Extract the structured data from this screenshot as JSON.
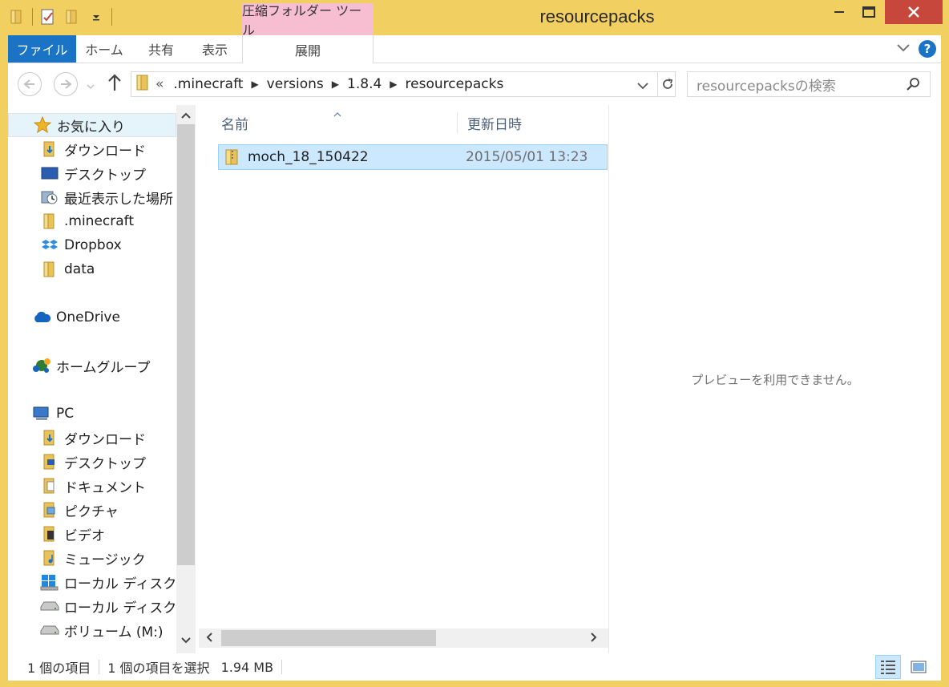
{
  "window": {
    "title": "resourcepacks",
    "context_tab_group": "圧縮フォルダー ツール"
  },
  "ribbon": {
    "tabs": [
      "ファイル",
      "ホーム",
      "共有",
      "表示",
      "展開"
    ]
  },
  "address_bar": {
    "overflow": "«",
    "crumbs": [
      ".minecraft",
      "versions",
      "1.8.4",
      "resourcepacks"
    ]
  },
  "search": {
    "placeholder": "resourcepacksの検索"
  },
  "nav_pane": {
    "favorites": {
      "label": "お気に入り",
      "items": [
        "ダウンロード",
        "デスクトップ",
        "最近表示した場所",
        ".minecraft",
        "Dropbox",
        "data"
      ]
    },
    "onedrive": "OneDrive",
    "homegroup": "ホームグループ",
    "pc": {
      "label": "PC",
      "items": [
        "ダウンロード",
        "デスクトップ",
        "ドキュメント",
        "ピクチャ",
        "ビデオ",
        "ミュージック",
        "ローカル ディスク (C",
        "ローカル ディスク (D",
        "ボリューム (M:)"
      ]
    }
  },
  "file_list": {
    "columns": {
      "name": "名前",
      "date": "更新日時"
    },
    "rows": [
      {
        "name": "moch_18_150422",
        "date": "2015/05/01 13:23"
      }
    ]
  },
  "preview": {
    "message": "プレビューを利用できません。"
  },
  "status": {
    "count": "1 個の項目",
    "selected": "1 個の項目を選択",
    "size": "1.94 MB"
  },
  "colors": {
    "frame": "#F2CF61",
    "accent": "#1A73C4",
    "context_tab": "#F7BDD0",
    "selection": "#CCE8FF",
    "close": "#C7473C"
  }
}
